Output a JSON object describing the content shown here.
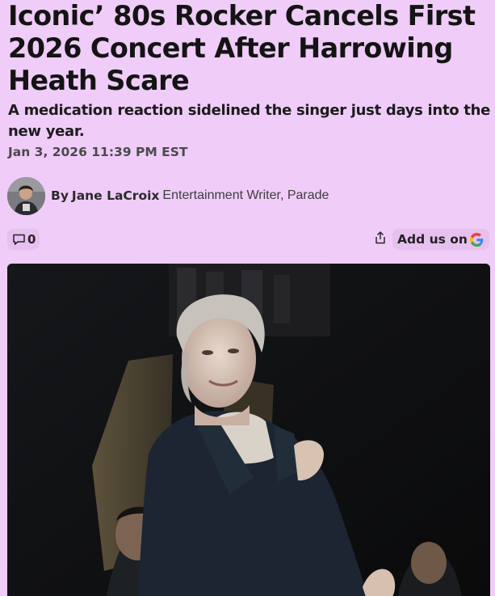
{
  "article": {
    "headline": "Iconic’ 80s Rocker Cancels First 2026 Concert After Harrowing Heath Scare",
    "dek": "A medication reaction sidelined the singer just days into the new year.",
    "date": "Jan 3, 2026 11:39 PM EST"
  },
  "byline": {
    "prefix": "By",
    "author": "Jane LaCroix",
    "title": "Entertainment Writer, Parade"
  },
  "actions": {
    "comment_count": "0",
    "add_us_label": "Add us on",
    "icons": {
      "comment": "comment-bubble-icon",
      "share": "share-icon",
      "google": "google-logo-icon"
    }
  },
  "colors": {
    "background": "#f0ccf8",
    "pill_background": "#e6c0ee",
    "text": "#141414",
    "muted": "#4a4a4a"
  }
}
